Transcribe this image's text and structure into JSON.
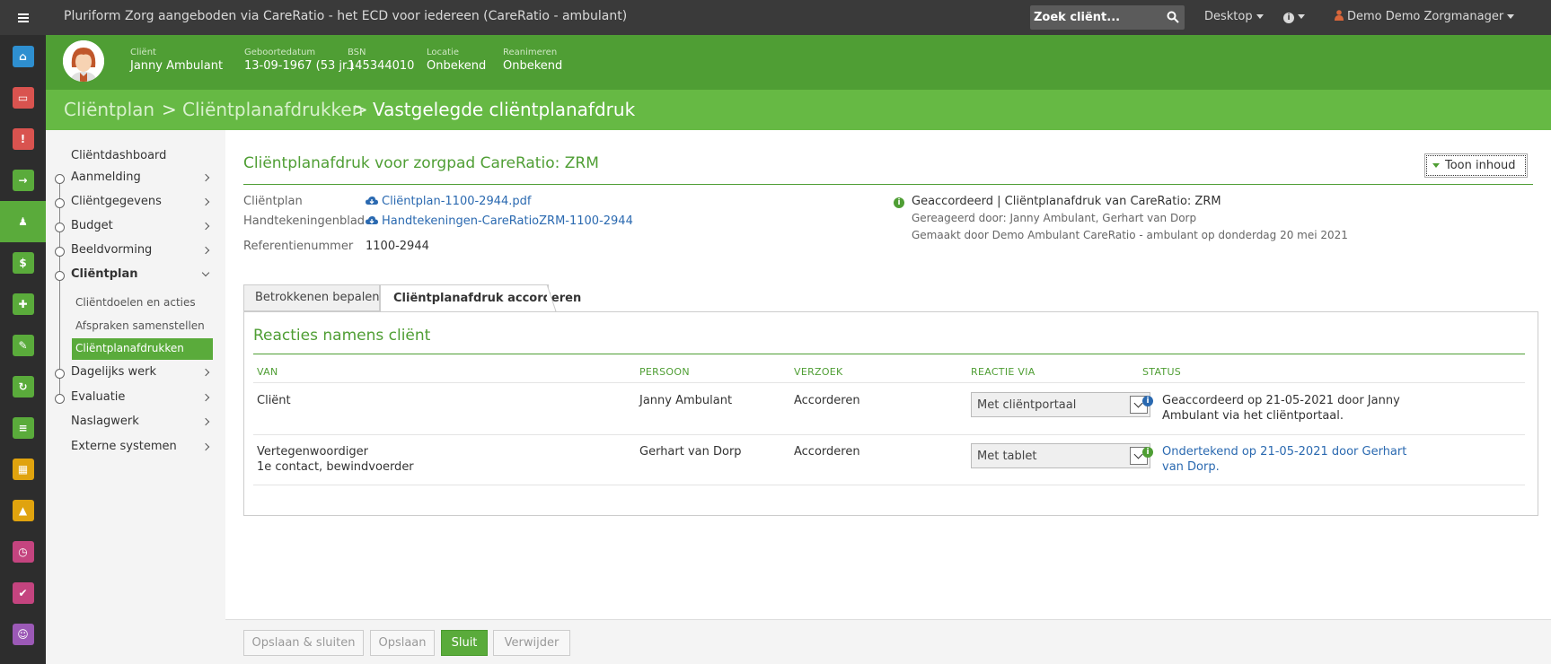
{
  "app": {
    "title": "Pluriform Zorg aangeboden via CareRatio - het ECD voor iedereen  (CareRatio - ambulant)",
    "search_placeholder": "Zoek cliënt...",
    "desktop_label": "Desktop",
    "user_label": "Demo Demo Zorgmanager"
  },
  "rail": {
    "items": [
      {
        "name": "home-icon",
        "color": "#2e8fd0"
      },
      {
        "name": "inbox-icon",
        "color": "#d9534f"
      },
      {
        "name": "warning-icon",
        "color": "#d9534f"
      },
      {
        "name": "login-icon",
        "color": "#5aab3b"
      },
      {
        "name": "client-icon",
        "color": "#5aab3b"
      },
      {
        "name": "money-icon",
        "color": "#5aab3b"
      },
      {
        "name": "puzzle-icon",
        "color": "#5aab3b"
      },
      {
        "name": "pencil-icon",
        "color": "#5aab3b"
      },
      {
        "name": "refresh-icon",
        "color": "#5aab3b"
      },
      {
        "name": "document-icon",
        "color": "#5aab3b"
      },
      {
        "name": "calendar-icon",
        "color": "#e0a30e"
      },
      {
        "name": "road-icon",
        "color": "#e0a30e"
      },
      {
        "name": "clock-icon",
        "color": "#c4447f"
      },
      {
        "name": "check-icon",
        "color": "#c4447f"
      },
      {
        "name": "user-icon",
        "color": "#9b59b6"
      }
    ]
  },
  "client": {
    "fields": [
      {
        "label": "Cliënt",
        "value": "Janny Ambulant"
      },
      {
        "label": "Geboortedatum",
        "value": "13-09-1967 (53 jr.)"
      },
      {
        "label": "BSN",
        "value": "145344010"
      },
      {
        "label": "Locatie",
        "value": "Onbekend"
      },
      {
        "label": "Reanimeren",
        "value": "Onbekend"
      }
    ]
  },
  "breadcrumb": {
    "items": [
      "Cliëntplan",
      "Cliëntplanafdrukken",
      "Vastgelegde cliëntplanafdruk"
    ],
    "separator": ">"
  },
  "sidebar": {
    "dashboard": "Cliëntdashboard",
    "items": [
      "Aanmelding",
      "Cliëntgegevens",
      "Budget",
      "Beeldvorming",
      "Cliëntplan",
      "Dagelijks werk",
      "Evaluatie"
    ],
    "subitems": [
      "Cliëntdoelen en acties",
      "Afspraken samenstellen",
      "Cliëntplanafdrukken"
    ],
    "extra": [
      "Naslagwerk",
      "Externe systemen"
    ]
  },
  "main": {
    "title": "Cliëntplanafdruk voor zorgpad CareRatio: ZRM",
    "toggle_button": "Toon inhoud",
    "meta": [
      {
        "label": "Cliëntplan",
        "value": "Cliëntplan-1100-2944.pdf"
      },
      {
        "label": "Handtekeningenblad",
        "value": "Handtekeningen-CareRatioZRM-1100-2944"
      },
      {
        "label": "Referentienummer",
        "value": "1100-2944"
      }
    ],
    "status": {
      "line1": "Geaccordeerd | Cliëntplanafdruk van CareRatio: ZRM",
      "line2": "Gereageerd door: Janny Ambulant, Gerhart van Dorp",
      "line3": "Gemaakt door Demo Ambulant CareRatio - ambulant op donderdag 20 mei 2021"
    },
    "tabs": [
      "Betrokkenen bepalen",
      "Cliëntplanafdruk accorderen"
    ],
    "panel_title": "Reacties namens cliënt",
    "columns": [
      "VAN",
      "PERSOON",
      "VERZOEK",
      "REACTIE VIA",
      "STATUS"
    ],
    "rows": [
      {
        "van": "Cliënt",
        "van2": "",
        "persoon": "Janny Ambulant",
        "verzoek": "Accorderen",
        "reactie": "Met cliëntportaal",
        "status": "Geaccordeerd op 21-05-2021 door Janny Ambulant via het cliëntportaal."
      },
      {
        "van": "Vertegenwoordiger",
        "van2": "1e contact, bewindvoerder",
        "persoon": "Gerhart van Dorp",
        "verzoek": "Accorderen",
        "reactie": "Met tablet",
        "status": "Ondertekend op 21-05-2021 door Gerhart van Dorp."
      }
    ]
  },
  "footer": {
    "buttons": [
      "Opslaan & sluiten",
      "Opslaan",
      "Sluit",
      "Verwijder"
    ]
  }
}
